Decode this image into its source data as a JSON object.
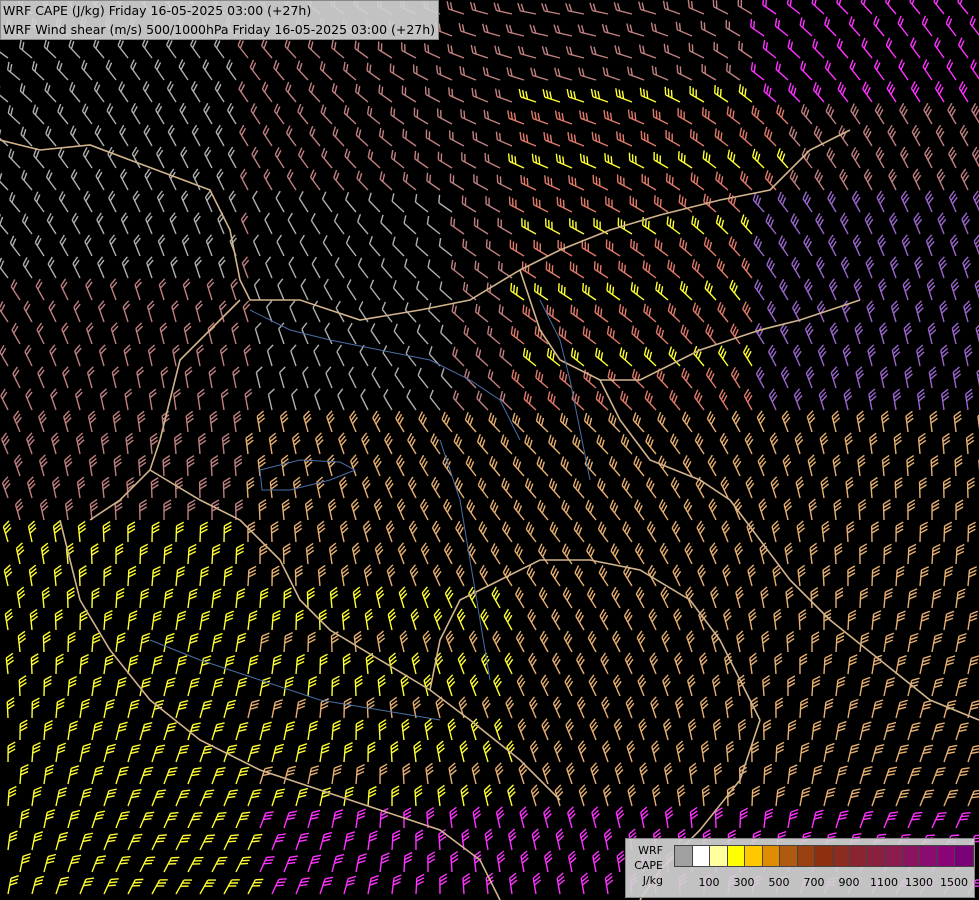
{
  "header": {
    "line1": "WRF CAPE (J/kg) Friday 16-05-2025 03:00 (+27h)",
    "line2": "WRF Wind shear (m/s) 500/1000hPa Friday 16-05-2025 03:00 (+27h)"
  },
  "legend": {
    "label_line1": "WRF",
    "label_line2": "CAPE",
    "label_line3": "J/kg",
    "swatch_colors": [
      "#a0a0a0",
      "#ffffff",
      "#ffffa0",
      "#ffff00",
      "#ffc800",
      "#e08c00",
      "#b05a10",
      "#9a4010",
      "#8c3010",
      "#8c2c20",
      "#8a2430",
      "#8a2040",
      "#8a1c50",
      "#8a1460",
      "#8a0c70",
      "#8a0478",
      "#7a0078"
    ],
    "ticks": [
      "100",
      "300",
      "500",
      "700",
      "900",
      "1100",
      "1300",
      "1500"
    ]
  },
  "map": {
    "background_color": "#000000",
    "border_color": "#d2b48c",
    "river_color": "#4a6fa5",
    "barb_colors": {
      "weak": "#b0b0b0",
      "light": "#c08080",
      "moderate": "#e07a6a",
      "strong": "#ff6060",
      "magenta": "#ff33ff",
      "yellow": "#ffff33",
      "tan": "#e8b070",
      "purple": "#9966cc"
    }
  }
}
